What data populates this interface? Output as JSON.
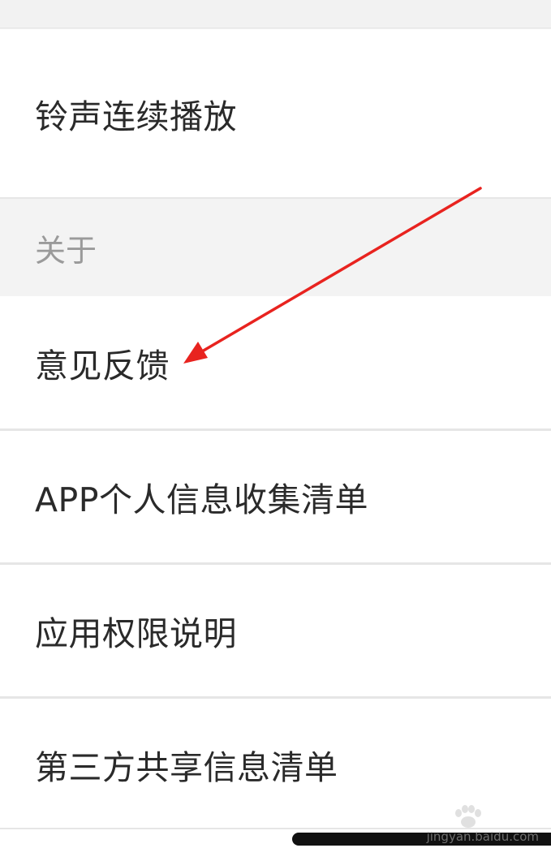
{
  "settings": {
    "ringtone_row": {
      "label": "铃声连续播放"
    },
    "section_about": {
      "label": "关于"
    },
    "items": [
      {
        "label": "意见反馈"
      },
      {
        "label": "APP个人信息收集清单"
      },
      {
        "label": "应用权限说明"
      },
      {
        "label": "第三方共享信息清单"
      }
    ]
  },
  "watermark": {
    "text": "jingyan.baidu.com"
  },
  "colors": {
    "annotation_arrow": "#e8231f",
    "row_background": "#ffffff",
    "section_background": "#f3f3f3",
    "label_text": "#2a2a2a",
    "section_text": "#9a9a9a"
  }
}
